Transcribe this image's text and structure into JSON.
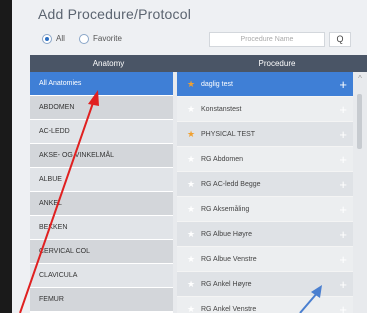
{
  "header": {
    "title": "Add Procedure/Protocol"
  },
  "filter": {
    "all_label": "All",
    "favorite_label": "Favorite",
    "search_placeholder": "Procedure Name",
    "search_icon": "Q"
  },
  "anatomy": {
    "header": "Anatomy",
    "items": [
      {
        "label": "All Anatomies"
      },
      {
        "label": "ABDOMEN"
      },
      {
        "label": "AC-LEDD"
      },
      {
        "label": "AKSE- OG VINKELMÅL"
      },
      {
        "label": "ALBUE"
      },
      {
        "label": "ANKEL"
      },
      {
        "label": "BEKKEN"
      },
      {
        "label": "CERVICAL COL"
      },
      {
        "label": "CLAVICULA"
      },
      {
        "label": "FEMUR"
      }
    ]
  },
  "procedure": {
    "header": "Procedure",
    "items": [
      {
        "label": "daglig test",
        "favorite": true
      },
      {
        "label": "Konstanstest",
        "favorite": false
      },
      {
        "label": "PHYSICAL TEST",
        "favorite": true
      },
      {
        "label": "RG Abdomen",
        "favorite": false
      },
      {
        "label": "RG AC-ledd Begge",
        "favorite": false
      },
      {
        "label": "RG Aksemåling",
        "favorite": false
      },
      {
        "label": "RG Albue Høyre",
        "favorite": false
      },
      {
        "label": "RG Albue Venstre",
        "favorite": false
      },
      {
        "label": "RG Ankel Høyre",
        "favorite": false
      },
      {
        "label": "RG Ankel Venstre",
        "favorite": false
      }
    ]
  },
  "icons": {
    "star": "★",
    "plus": "+",
    "scroll_up": "^",
    "scroll_down": "v"
  },
  "colors": {
    "header_bg": "#4a5566",
    "selected": "#3f7fd6",
    "favorite_star": "#f0a030",
    "red_arrow": "#e02020",
    "blue_arrow": "#4a7fd0"
  }
}
